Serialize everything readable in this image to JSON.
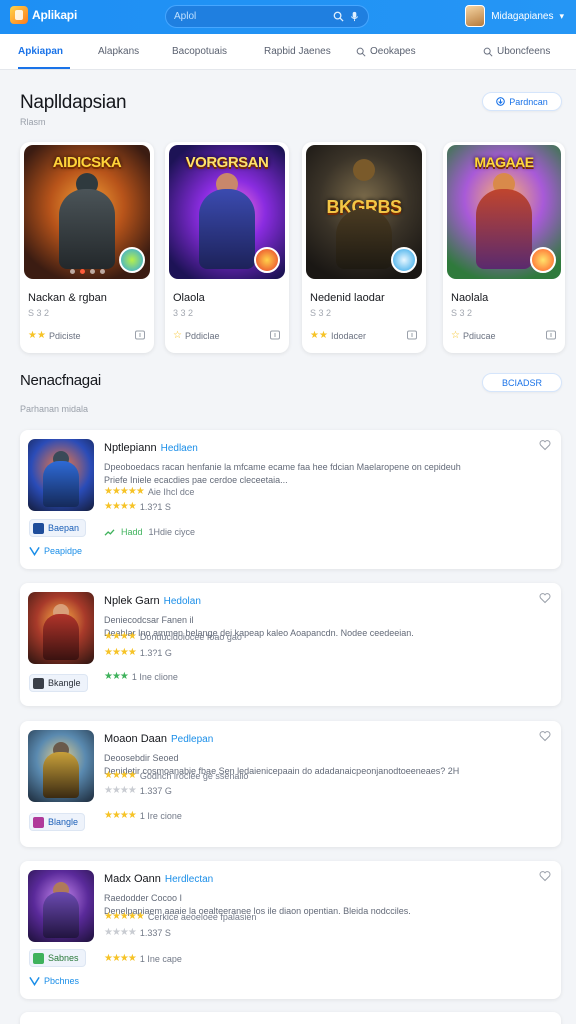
{
  "header": {
    "logo_text": "Aplikapi",
    "search_placeholder": "Aplol",
    "user_name": "Midagapianes",
    "user_caret": "▾"
  },
  "tabs": [
    {
      "label": "Apkiapan",
      "active": true
    },
    {
      "label": "Alapkans"
    },
    {
      "label": "Bacopotuais"
    },
    {
      "label": "Rapbid Jaenes"
    },
    {
      "label": "Oeokapes"
    },
    {
      "label": "Uboncfeens"
    }
  ],
  "featured": {
    "title": "Naplldapsian",
    "subtitle": "Rlasm",
    "action_label": "Pardncan",
    "cards": [
      {
        "art_title": "AIDICSKA",
        "name": "Nackan & rgban",
        "meta": "S 3 2",
        "rating_label": "Pdiciste",
        "accent": "#2aa4e8"
      },
      {
        "art_title": "VORGRSAN",
        "name": "Olaola",
        "meta": "3 3 2",
        "rating_label": "Pddiclae",
        "accent": "#ff8a1c"
      },
      {
        "art_title": "BKGRBS",
        "name": "Nedenid laodar",
        "meta": "S 3 2",
        "rating_label": "Idodacer",
        "accent": "#2aa4e8"
      },
      {
        "art_title": "MAGAAE",
        "name": "Naolala",
        "meta": "S 3 2",
        "rating_label": "Pdiucae",
        "accent": "#ff8a1c"
      }
    ]
  },
  "list_section": {
    "title": "Nenacfnagai",
    "subtitle": "Parhanan midala",
    "action_label": "BCIADSR",
    "items": [
      {
        "name": "Nptlepiann",
        "tag": "Hedlaen",
        "desc_line1": "Dpeoboedacs racan henfanie la mfcame ecame faa hee fdcian Maelaropene on cepideuh",
        "desc_line2": "Priefe Iniele ecacdies pae cerdoe cleceetaia...",
        "desc_line3": "Aie Ihcl dce",
        "rating": "1.3?1 S",
        "plays": "1Hdie ciyce",
        "button_label": "Baepan",
        "link_label": "Peapidpe"
      },
      {
        "name": "Nplek Garn",
        "tag": "Hedolan",
        "desc_line1": "Deniecodcsar Fanen il",
        "desc_line2": "Deahlar Ino ammen belange dei kapeap kaleo Aoapancdn. Nodee ceedeeian.",
        "desc_line3": "Donducidoiocee foao gao",
        "rating": "1.3?1 G",
        "plays": "1 Ine clione",
        "button_label": "Bkangle",
        "link_label": ""
      },
      {
        "name": "Moaon Daan",
        "tag": "Pedlepan",
        "desc_line1": "Deoosebdir Seoed",
        "desc_line2": "Denidetir cosmoanabie fbae Sen ledaienicepaain do adadanaicpeonjanodtoeeneaes? 2H",
        "desc_line3": "Godhch lroclee ge ssenalio",
        "rating": "1.337 G",
        "plays": "1 Ire cione",
        "button_label": "Blangle",
        "link_label": ""
      },
      {
        "name": "Madx Oann",
        "tag": "Herdlectan",
        "desc_line1": "Raedodder Cocoo I",
        "desc_line2": "Denelpapiaem aaaie la oealteeranee los ile diaon opentian. Bleida nodcciles.",
        "desc_line3": "Cerkice aeoeloee fpalasien",
        "rating": "1.337 S",
        "plays": "1 Ine cape",
        "button_label": "Sabnes",
        "link_label": "Pbchnes"
      }
    ]
  }
}
